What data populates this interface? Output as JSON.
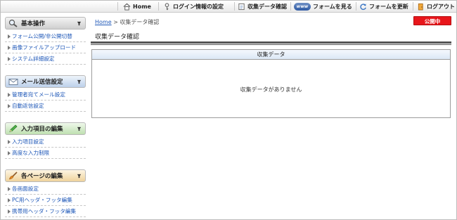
{
  "topnav": {
    "items": [
      {
        "label": "Home",
        "icon": "home-icon"
      },
      {
        "label": "ログイン情報の設定",
        "icon": "key-icon"
      },
      {
        "label": "収集データ確認",
        "icon": "document-icon"
      },
      {
        "label": "フォームを見る",
        "icon": "www-icon",
        "badge": "www"
      },
      {
        "label": "フォームを更新",
        "icon": "refresh-icon"
      },
      {
        "label": "ログアウト",
        "icon": "logout-icon"
      }
    ]
  },
  "sidebar": {
    "sections": [
      {
        "title": "基本操作",
        "icon": "magnifier-icon",
        "accent": "#cccccc",
        "items": [
          "フォーム公開/非公開切替",
          "画像ファイルアップロード",
          "システム詳細設定"
        ]
      },
      {
        "title": "メール送信設定",
        "icon": "mail-icon",
        "accent": "#bfd3ec",
        "items": [
          "管理者宛てメール設定",
          "自動返信設定"
        ]
      },
      {
        "title": "入力項目の編集",
        "icon": "pencil-icon",
        "accent": "#c4e3b8",
        "items": [
          "入力項目設定",
          "高度な入力制限"
        ]
      },
      {
        "title": "各ページの編集",
        "icon": "brush-icon",
        "accent": "#f1d9a8",
        "items": [
          "各画面設定",
          "PC用ヘッダ・フッタ編集",
          "携帯用ヘッダ・フッタ編集"
        ]
      }
    ]
  },
  "breadcrumb": {
    "home": "Home",
    "separator": " > ",
    "current": "収集データ確認"
  },
  "status": {
    "label": "公開中",
    "color": "#e8161b"
  },
  "main": {
    "title": "収集データ確認",
    "panel_header": "収集データ",
    "empty_message": "収集データがありません"
  }
}
